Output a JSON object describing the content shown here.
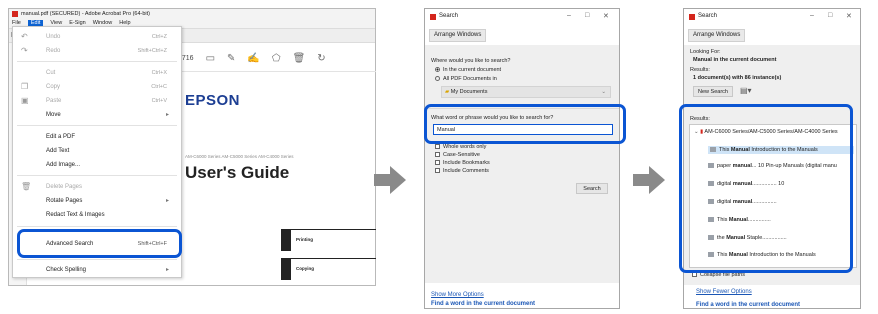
{
  "acrobat": {
    "title": "manual.pdf (SECURED) - Adobe Acrobat Pro (64-bit)",
    "menu": [
      "File",
      "Edit",
      "View",
      "E-Sign",
      "Window",
      "Help"
    ],
    "tab_home": "Ho",
    "page_count": "/ 716",
    "doc": {
      "brand": "EPSON",
      "series": "AM-C6000 Series   AM-C5000 Series   AM-C4000 Series",
      "title": "User's Guide",
      "sections": [
        "Printing",
        "Copying"
      ]
    },
    "edit_menu": {
      "undo": {
        "label": "Undo",
        "shortcut": "Ctrl+Z"
      },
      "redo": {
        "label": "Redo",
        "shortcut": "Shift+Ctrl+Z"
      },
      "cut": {
        "label": "Cut",
        "shortcut": "Ctrl+X"
      },
      "copy": {
        "label": "Copy",
        "shortcut": "Ctrl+C"
      },
      "paste": {
        "label": "Paste",
        "shortcut": "Ctrl+V"
      },
      "move": {
        "label": "Move"
      },
      "edit_pdf": {
        "label": "Edit a PDF"
      },
      "add_text": {
        "label": "Add Text"
      },
      "add_image": {
        "label": "Add Image..."
      },
      "delete_pages": {
        "label": "Delete Pages"
      },
      "rotate_pages": {
        "label": "Rotate Pages"
      },
      "redact": {
        "label": "Redact Text & Images"
      },
      "advanced_search": {
        "label": "Advanced Search",
        "shortcut": "Shift+Ctrl+F"
      },
      "check_spelling": {
        "label": "Check Spelling"
      }
    }
  },
  "search1": {
    "title": "Search",
    "arrange": "Arrange Windows",
    "where_q": "Where would you like to search?",
    "opt_current": "In the current document",
    "opt_all": "All PDF Documents in",
    "location": "My Documents",
    "what_q": "What word or phrase would you like to search for?",
    "query": "Manual",
    "whole_words": "Whole words only",
    "case_sensitive": "Case-Sensitive",
    "include_bookmarks": "Include Bookmarks",
    "include_comments": "Include Comments",
    "search_btn": "Search",
    "more_options": "Show More Options",
    "find_link": "Find a word in the current document"
  },
  "search2": {
    "title": "Search",
    "arrange": "Arrange Windows",
    "looking_for_label": "Looking For:",
    "looking_for_value": "Manual in the current document",
    "results_label": "Results:",
    "results_summary": "1 document(s) with 86 instance(s)",
    "new_search": "New Search",
    "results_list_label": "Results:",
    "root": "AM-C6000 Series/AM-C5000 Series/AM-C4000 Series",
    "rows": [
      {
        "pre": "This ",
        "bold": "Manual",
        "post": " Introduction to the Manuals"
      },
      {
        "pre": "paper ",
        "bold": "manual",
        "post": "... 10 Pin-up Manuals (digital manu"
      },
      {
        "pre": "digital ",
        "bold": "manual",
        "post": "................ 10"
      },
      {
        "pre": "digital ",
        "bold": "manual",
        "post": "................"
      },
      {
        "pre": "This ",
        "bold": "Manual",
        "post": "..............."
      },
      {
        "pre": "the ",
        "bold": "Manual",
        "post": " Staple................"
      },
      {
        "pre": "This ",
        "bold": "Manual",
        "post": " Introduction to the Manuals"
      }
    ],
    "collapse": "Collapse file paths",
    "fewer_options": "Show Fewer Options",
    "find_link": "Find a word in the current document"
  }
}
